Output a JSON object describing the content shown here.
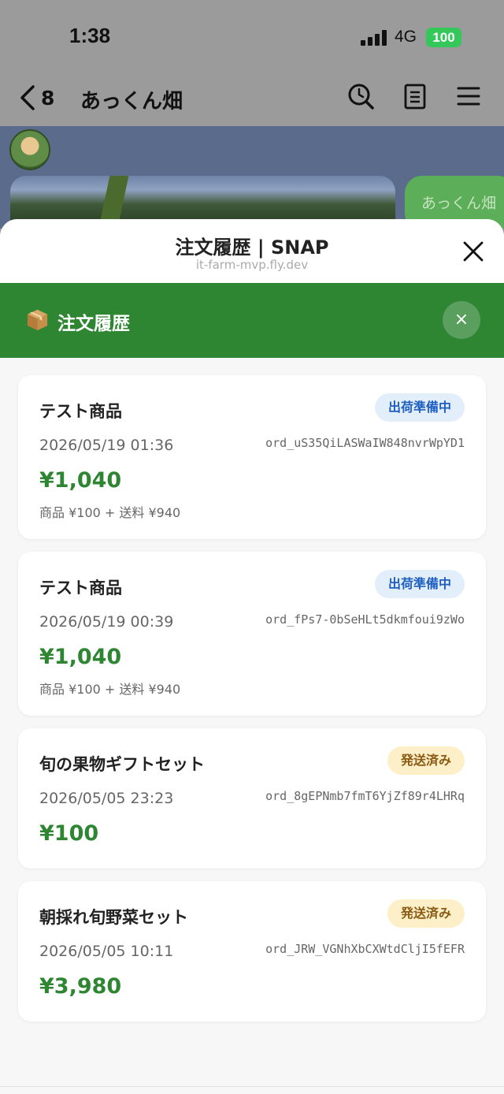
{
  "status_bar": {
    "time": "1:38",
    "network": "4G",
    "battery": "100"
  },
  "chat_header": {
    "back_count": "8",
    "title": "あっくん畑"
  },
  "chat": {
    "bubble_text": "あっくん畑"
  },
  "sheet": {
    "title": "注文履歴 | SNAP",
    "url": "it-farm-mvp.fly.dev"
  },
  "banner": {
    "title": "注文履歴",
    "close_label": "×"
  },
  "orders": [
    {
      "name": "テスト商品",
      "status": "出荷準備中",
      "date": "2026/05/19 01:36",
      "id": "ord_uS35QiLASWaIW848nvrWpYD1",
      "total": "¥1,040",
      "breakdown": "商品 ¥100 + 送料 ¥940"
    },
    {
      "name": "テスト商品",
      "status": "出荷準備中",
      "date": "2026/05/19 00:39",
      "id": "ord_fPs7-0bSeHLt5dkmfoui9zWo",
      "total": "¥1,040",
      "breakdown": "商品 ¥100 + 送料 ¥940"
    },
    {
      "name": "旬の果物ギフトセット",
      "status": "発送済み",
      "date": "2026/05/05 23:23",
      "id": "ord_8gEPNmb7fmT6YjZf89r4LHRq",
      "total": "¥100"
    },
    {
      "name": "朝採れ旬野菜セット",
      "status": "発送済み",
      "date": "2026/05/05 10:11",
      "id": "ord_JRW_VGNhXbCXWtdCljI5fEFR",
      "total": "¥3,980"
    }
  ],
  "colors": {
    "accent_green": "#2e8532",
    "prep_badge_bg": "#e3eefb",
    "prep_badge_text": "#1f5fbf",
    "shipped_badge_bg": "#fdf0c8",
    "shipped_badge_text": "#8a5a12"
  },
  "icons": [
    "back-chevron-icon",
    "search-icon",
    "notes-icon",
    "menu-icon",
    "close-icon",
    "package-icon",
    "signal-icon",
    "battery-icon"
  ]
}
